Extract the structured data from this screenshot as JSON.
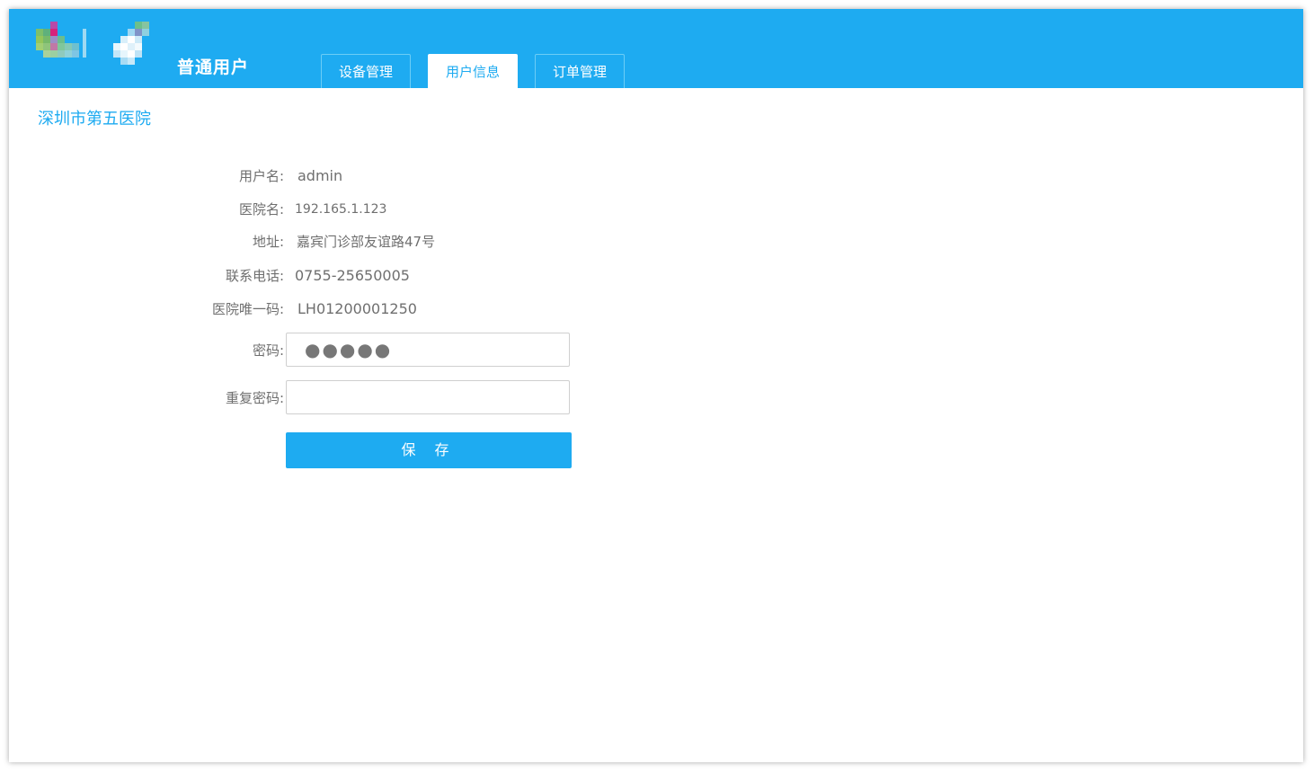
{
  "header": {
    "role": "普通用户",
    "brand_color": "#1eabf1",
    "tabs": [
      {
        "label": "设备管理",
        "active": false
      },
      {
        "label": "用户信息",
        "active": true
      },
      {
        "label": "订单管理",
        "active": false
      }
    ]
  },
  "main": {
    "hospital_title": "深圳市第五医院",
    "fields": {
      "username_label": "用户名:",
      "username_value": "admin",
      "hospital_name_label": "医院名:",
      "hospital_name_value": "192.165.1.123",
      "address_label": "地址:",
      "address_value": "嘉宾门诊部友谊路47号",
      "phone_label": "联系电话:",
      "phone_value": "0755-25650005",
      "unique_code_label": "医院唯一码:",
      "unique_code_value": "LH01200001250",
      "password_label": "密码:",
      "password_value": "●●●●●",
      "repeat_password_label": "重复密码:",
      "repeat_password_value": ""
    },
    "save_label": "保 存"
  }
}
